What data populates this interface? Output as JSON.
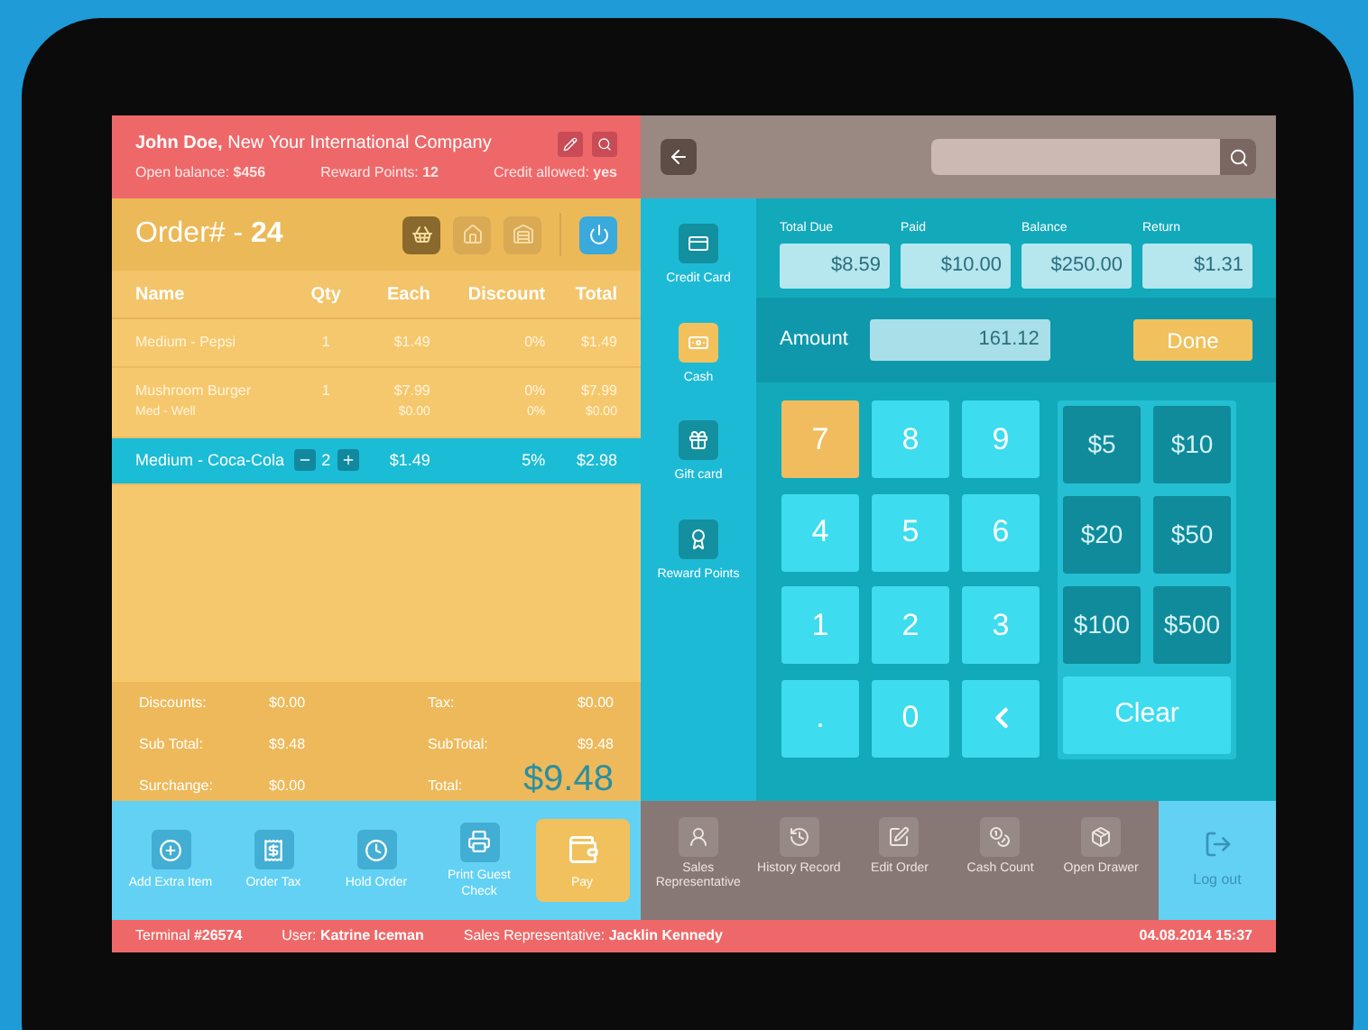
{
  "customer": {
    "name_line": "**John Doe,** New Your International Company",
    "open_balance": "Open balance: **$456**",
    "reward_points": "Reward Points: **12**",
    "credit_allowed": "Credit allowed: **yes**"
  },
  "order": {
    "title": "Order# - **24**"
  },
  "order_modes": [
    {
      "kind": "basket",
      "selected": true
    },
    {
      "kind": "home",
      "selected": false
    },
    {
      "kind": "store",
      "selected": false
    }
  ],
  "columns": [
    "Name",
    "Qty",
    "Each",
    "Discount",
    "Total"
  ],
  "rows": [
    {
      "name": "Medium - Pepsi",
      "qty": "1",
      "each": "$1.49",
      "discount": "0%",
      "total": "$1.49",
      "selected": false
    },
    {
      "name": "Mushroom Burger",
      "qty": "1",
      "each": "$7.99",
      "discount": "0%",
      "total": "$7.99",
      "selected": false,
      "modifier": {
        "name": "Med - Well",
        "each": "$0.00",
        "discount": "0%",
        "total": "$0.00"
      }
    },
    {
      "name": "Medium - Coca-Cola",
      "qty": "2",
      "each": "$1.49",
      "discount": "5%",
      "total": "$2.98",
      "selected": true
    }
  ],
  "summary_left": [
    {
      "label": "Discounts:",
      "value": "$0.00"
    },
    {
      "label": "Sub Total:",
      "value": "$9.48"
    },
    {
      "label": "Surchange:",
      "value": "$0.00"
    }
  ],
  "summary_right": [
    {
      "kind": "line",
      "label": "Tax:",
      "value": "$0.00"
    },
    {
      "kind": "line",
      "label": "SubTotal:",
      "value": "$9.48"
    },
    {
      "kind": "grand",
      "label": "Total:",
      "value": "$9.48"
    }
  ],
  "actions": [
    {
      "kind": "add",
      "label": "Add Extra Item",
      "selected": false
    },
    {
      "kind": "tax",
      "label": "Order Tax",
      "selected": false
    },
    {
      "kind": "hold",
      "label": "Hold Order",
      "selected": false
    },
    {
      "kind": "print",
      "label": "Print Guest Check",
      "selected": false
    },
    {
      "kind": "pay",
      "label": "Pay",
      "selected": true
    }
  ],
  "payment_methods": [
    {
      "kind": "card",
      "label": "Credit Card",
      "selected": false
    },
    {
      "kind": "cash",
      "label": "Cash",
      "selected": true
    },
    {
      "kind": "gift",
      "label": "Gift card",
      "selected": false
    },
    {
      "kind": "reward",
      "label": "Reward Points",
      "selected": false
    }
  ],
  "totals": [
    {
      "label": "Total Due",
      "value": "$8.59"
    },
    {
      "label": "Paid",
      "value": "$10.00"
    },
    {
      "label": "Balance",
      "value": "$250.00"
    },
    {
      "label": "Return",
      "value": "$1.31"
    }
  ],
  "amount": {
    "label": "Amount",
    "value": "161.12"
  },
  "done": "Done",
  "keypad": [
    {
      "kind": "digit",
      "label": "7",
      "selected": true
    },
    {
      "kind": "digit",
      "label": "8",
      "selected": false
    },
    {
      "kind": "digit",
      "label": "9",
      "selected": false
    },
    {
      "kind": "digit",
      "label": "4",
      "selected": false
    },
    {
      "kind": "digit",
      "label": "5",
      "selected": false
    },
    {
      "kind": "digit",
      "label": "6",
      "selected": false
    },
    {
      "kind": "digit",
      "label": "1",
      "selected": false
    },
    {
      "kind": "digit",
      "label": "2",
      "selected": false
    },
    {
      "kind": "digit",
      "label": "3",
      "selected": false
    },
    {
      "kind": "digit",
      "label": ".",
      "selected": false
    },
    {
      "kind": "digit",
      "label": "0",
      "selected": false
    },
    {
      "kind": "back",
      "selected": false
    }
  ],
  "quick_amounts": [
    "$5",
    "$10",
    "$20",
    "$50",
    "$100",
    "$500"
  ],
  "clear": "Clear",
  "tools": [
    {
      "kind": "rep",
      "label": "Sales Representative"
    },
    {
      "kind": "history",
      "label": "History Record"
    },
    {
      "kind": "edit",
      "label": "Edit Order"
    },
    {
      "kind": "cash",
      "label": "Cash Count"
    },
    {
      "kind": "drawer",
      "label": "Open Drawer"
    }
  ],
  "logout": "Log out",
  "status": {
    "terminal": "Terminal **#26574**",
    "user": "User: **Katrine Iceman**",
    "rep": "Sales Representative: **Jacklin Kennedy**",
    "datetime": "04.08.2014 15:37"
  }
}
